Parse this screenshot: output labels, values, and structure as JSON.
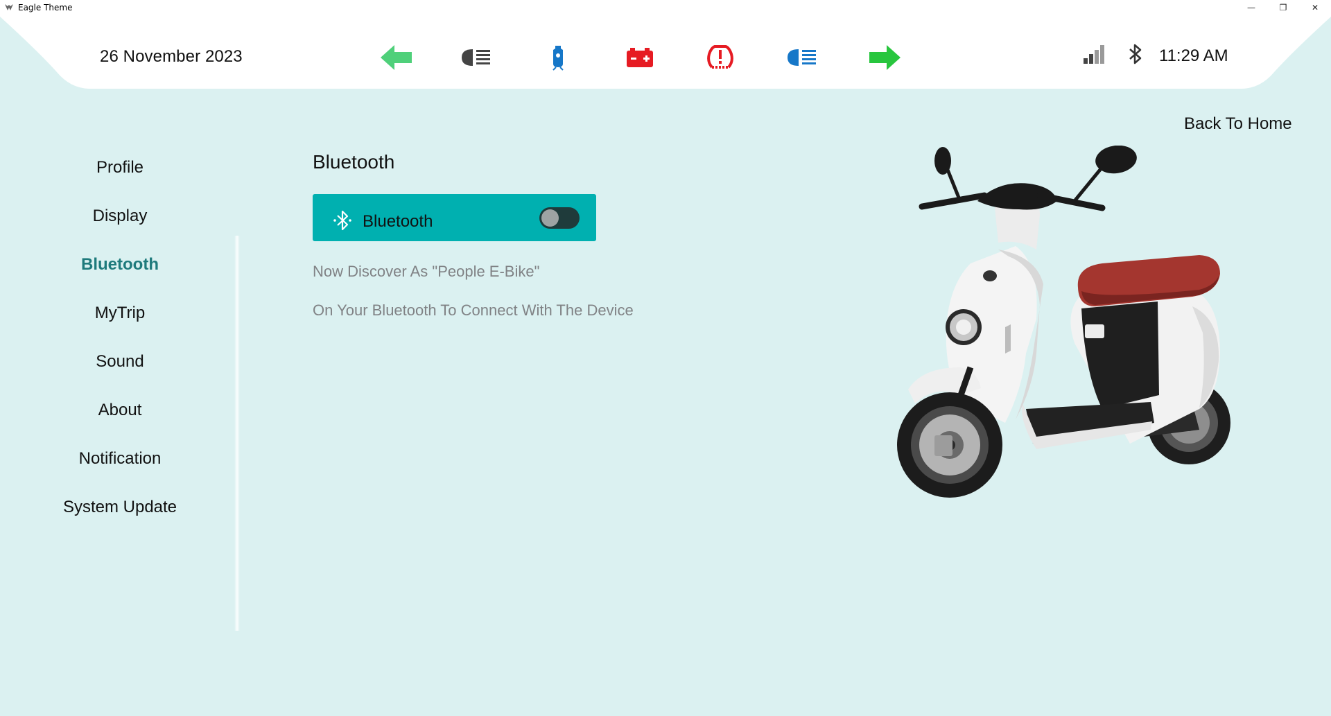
{
  "window": {
    "title": "Eagle Theme",
    "controls": {
      "minimize": "—",
      "restore": "❐",
      "close": "✕"
    }
  },
  "header": {
    "date": "26 November 2023",
    "time": "11:29 AM",
    "indicators": [
      {
        "name": "left-turn",
        "color": "#4fd07a"
      },
      {
        "name": "low-beam",
        "color": "#444444"
      },
      {
        "name": "side-stand",
        "color": "#1677c8"
      },
      {
        "name": "battery",
        "color": "#e61b23"
      },
      {
        "name": "tire-pressure",
        "color": "#e61b23"
      },
      {
        "name": "high-beam",
        "color": "#1677c8"
      },
      {
        "name": "right-turn",
        "color": "#28c63e"
      }
    ]
  },
  "nav": {
    "back_home": "Back To Home"
  },
  "sidebar": {
    "items": [
      {
        "label": "Profile",
        "active": false
      },
      {
        "label": "Display",
        "active": false
      },
      {
        "label": "Bluetooth",
        "active": true
      },
      {
        "label": "MyTrip",
        "active": false
      },
      {
        "label": "Sound",
        "active": false
      },
      {
        "label": "About",
        "active": false
      },
      {
        "label": "Notification",
        "active": false
      },
      {
        "label": "System Update",
        "active": false
      }
    ]
  },
  "main": {
    "title": "Bluetooth",
    "card": {
      "label": "Bluetooth",
      "toggle_on": false
    },
    "discover_text": "Now Discover As \"People E-Bike\"",
    "instruction_text": "On Your Bluetooth To Connect With The Device"
  },
  "colors": {
    "background": "#dbf1f1",
    "accent": "#00b0b0",
    "active_nav": "#1e7a7c",
    "muted_text": "#808285"
  }
}
